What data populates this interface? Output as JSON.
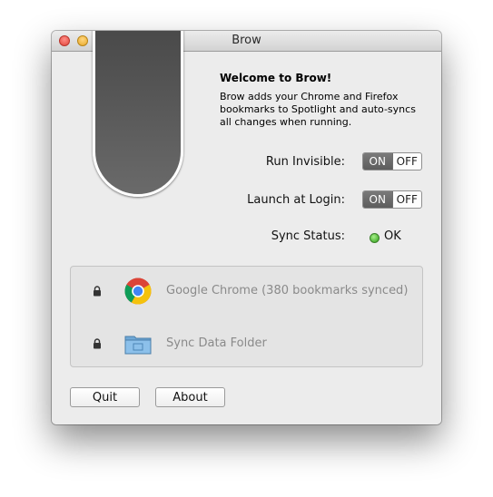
{
  "window": {
    "title": "Brow"
  },
  "welcome": {
    "title": "Welcome to Brow!",
    "body": "Brow adds your Chrome and Firefox bookmarks to Spotlight and auto-syncs all changes when running."
  },
  "settings": {
    "run_invisible": {
      "label": "Run Invisible:",
      "on_label": "ON",
      "off_label": "OFF",
      "value": "ON"
    },
    "launch_at_login": {
      "label": "Launch at Login:",
      "on_label": "ON",
      "off_label": "OFF",
      "value": "ON"
    },
    "sync_status": {
      "label": "Sync Status:",
      "value": "OK",
      "indicator_color": "#3fbf25"
    }
  },
  "sources": [
    {
      "label": "Google Chrome (380 bookmarks synced)",
      "icon": "chrome-icon",
      "lock": "lock-icon"
    },
    {
      "label": "Sync Data Folder",
      "icon": "folder-icon",
      "lock": "lock-icon"
    }
  ],
  "buttons": {
    "quit": "Quit",
    "about": "About"
  }
}
